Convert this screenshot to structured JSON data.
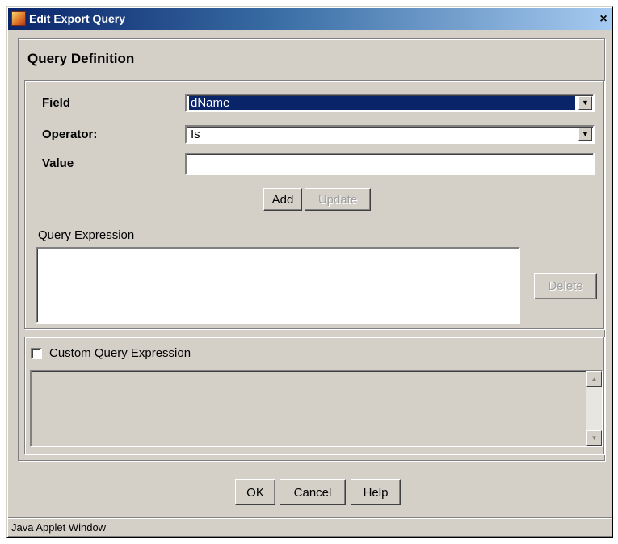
{
  "window": {
    "title": "Edit Export Query",
    "close_glyph": "×",
    "icon": "applet-icon"
  },
  "panel": {
    "title": "Query Definition"
  },
  "form": {
    "field_label": "Field",
    "field_value": "dName",
    "operator_label": "Operator:",
    "operator_value": "Is",
    "value_label": "Value",
    "value_text": ""
  },
  "buttons": {
    "add": "Add",
    "update": "Update",
    "delete": "Delete",
    "ok": "OK",
    "cancel": "Cancel",
    "help": "Help"
  },
  "query": {
    "label": "Query Expression",
    "text": ""
  },
  "custom": {
    "checkbox_label": "Custom Query Expression",
    "checked": false,
    "text": ""
  },
  "status": {
    "text": "Java Applet Window"
  },
  "colors": {
    "dialog_bg": "#d4d0c8",
    "titlebar": "#0a246a",
    "selection": "#0a246a"
  }
}
